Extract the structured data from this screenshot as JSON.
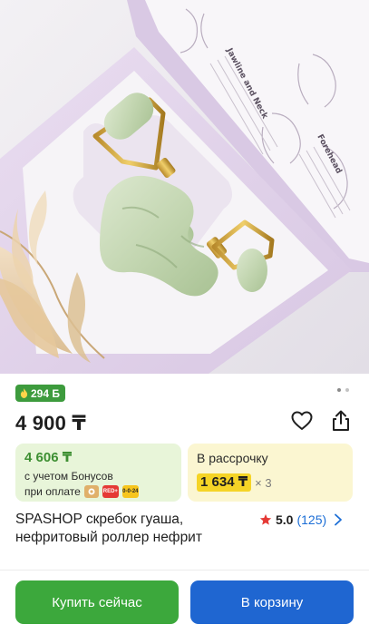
{
  "product_image": {
    "box_text": [
      "Jawline and Neck",
      "Forehead"
    ],
    "alt": "Jade roller and gua sha set"
  },
  "bonus_badge": {
    "value": "294 Б",
    "icon": "flame-icon",
    "color": "#3d9b3d"
  },
  "gallery": {
    "dots": 2,
    "active": 1
  },
  "price": "4 900 ₸",
  "actions": {
    "favorite_icon": "heart-icon",
    "share_icon": "share-icon"
  },
  "bonus_card": {
    "amount": "4 606 ₸",
    "line1": "с учетом Бонусов",
    "line2": "при оплате",
    "payment_icons": [
      {
        "name": "kaspi-icon",
        "text": ""
      },
      {
        "name": "red-plus-icon",
        "text": "RED+"
      },
      {
        "name": "0-0-24-icon",
        "text": "0-0-24"
      }
    ]
  },
  "credit_card": {
    "label": "В рассрочку",
    "amount": "1 634 ₸",
    "multiplier": "× 3"
  },
  "product_title": "SPASHOP скребок гуаша, нефритовый роллер нефрит",
  "rating": {
    "score": "5.0",
    "count": "(125)"
  },
  "buttons": {
    "buy": "Купить сейчас",
    "cart": "В корзину"
  },
  "colors": {
    "accent_green": "#3ca83c",
    "accent_blue": "#1f66d1",
    "credit_yellow": "#f5d426"
  }
}
